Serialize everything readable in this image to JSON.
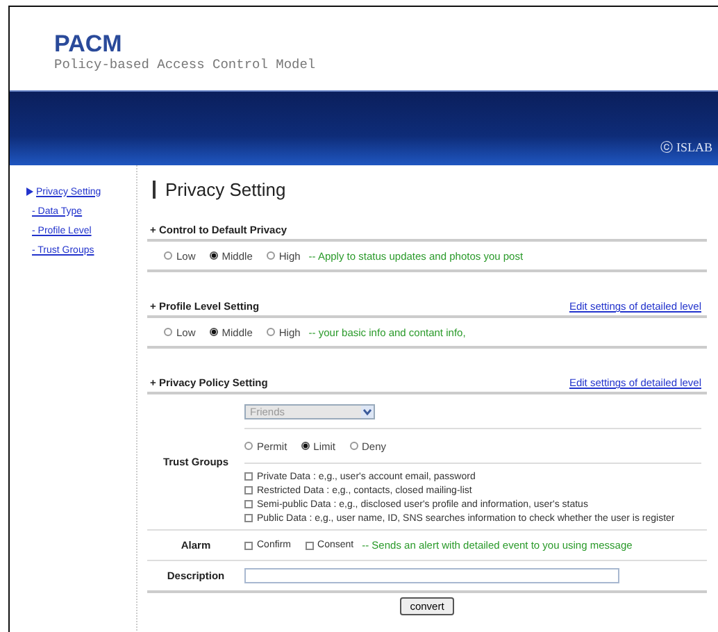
{
  "header": {
    "logo": "PACM",
    "subtitle": "Policy-based Access Control Model",
    "copyright": "ⓒ ISLAB"
  },
  "sidebar": {
    "items": [
      {
        "label": "Privacy Setting",
        "selected": true,
        "children": [
          {
            "label": "- Data Type",
            "selected": false
          },
          {
            "label": "- Profile Level",
            "selected": false
          },
          {
            "label": "- Trust Groups",
            "selected": false
          }
        ]
      }
    ]
  },
  "page_title": "Privacy Setting",
  "sections": [
    {
      "kind": "radios",
      "title": "+ Control to Default Privacy",
      "options": [
        {
          "label": "Low",
          "selected": false
        },
        {
          "label": "Middle",
          "selected": true
        },
        {
          "label": "High",
          "selected": false
        }
      ],
      "note": "-- Apply to status updates and photos you post"
    },
    {
      "kind": "radios",
      "title": "+ Profile Level Setting",
      "link": "Edit settings of detailed level",
      "options": [
        {
          "label": "Low",
          "selected": false
        },
        {
          "label": "Middle",
          "selected": true
        },
        {
          "label": "High",
          "selected": false
        }
      ],
      "note": "-- your basic info and contant info,"
    },
    {
      "kind": "policy",
      "title": "+ Privacy Policy Setting",
      "link": "Edit settings of detailed level",
      "trust_groups": {
        "label": "Trust Groups",
        "dropdown": {
          "value": "Friends",
          "disabled": true
        },
        "permissions": [
          {
            "label": "Permit",
            "selected": false
          },
          {
            "label": "Limit",
            "selected": true
          },
          {
            "label": "Deny",
            "selected": false
          }
        ],
        "data_types": [
          {
            "label": "Private Data : e,g., user's account email, password",
            "checked": false
          },
          {
            "label": "Restricted Data : e,g., contacts, closed mailing-list",
            "checked": false
          },
          {
            "label": "Semi-public Data : e,g., disclosed user's profile and information, user's status",
            "checked": false
          },
          {
            "label": "Public Data : e,g., user name, ID, SNS searches information to check whether the user is register",
            "checked": false
          }
        ]
      },
      "alarm": {
        "label": "Alarm",
        "options": [
          {
            "label": "Confirm",
            "checked": false
          },
          {
            "label": "Consent",
            "checked": false
          }
        ],
        "note": "-- Sends an alert with detailed event to you using message"
      },
      "description": {
        "label": "Description"
      },
      "button": "convert"
    }
  ]
}
